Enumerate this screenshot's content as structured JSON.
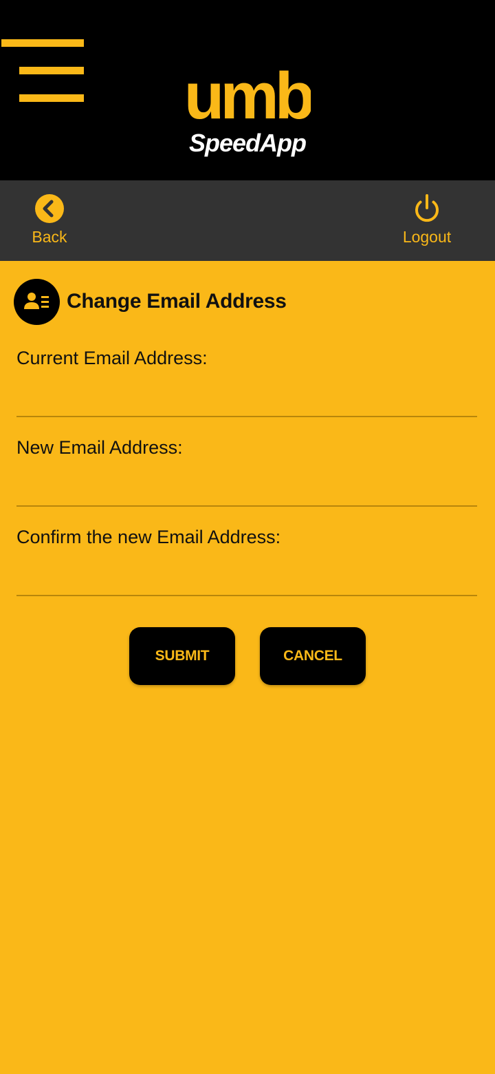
{
  "colors": {
    "accent": "#FAB818",
    "header_bg": "#000000",
    "nav_bg": "#333333",
    "text": "#111111"
  },
  "header": {
    "menu_icon": "hamburger-menu-icon",
    "logo_mark": "umb",
    "logo_text": "SpeedApp"
  },
  "nav": {
    "back": {
      "label": "Back",
      "icon": "chevron-left-circle-icon"
    },
    "logout": {
      "label": "Logout",
      "icon": "power-icon"
    }
  },
  "page": {
    "title": "Change Email Address",
    "title_icon": "user-contact-card-icon"
  },
  "form": {
    "current_email": {
      "label": "Current Email Address:",
      "value": ""
    },
    "new_email": {
      "label": "New Email Address:",
      "value": ""
    },
    "confirm_email": {
      "label": "Confirm the new Email Address:",
      "value": ""
    }
  },
  "buttons": {
    "submit_label": "SUBMIT",
    "cancel_label": "CANCEL"
  }
}
